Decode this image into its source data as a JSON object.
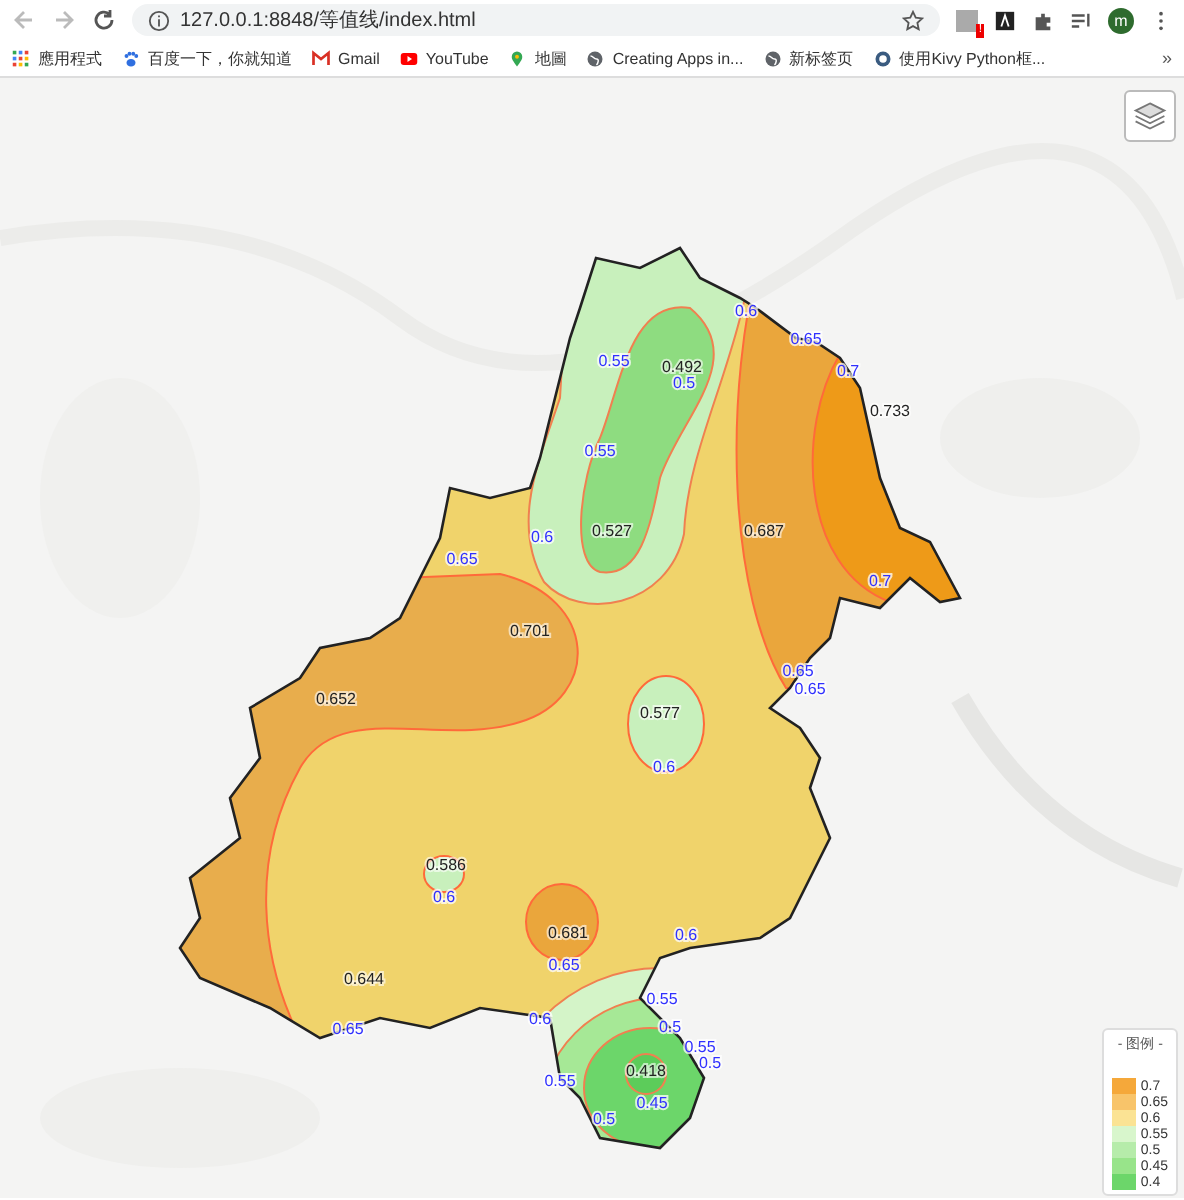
{
  "browser": {
    "url": "127.0.0.1:8848/等值线/index.html",
    "avatar": "m",
    "extension_badge": "!",
    "bookmarks": [
      {
        "kind": "apps",
        "label": "應用程式"
      },
      {
        "kind": "paw",
        "label": "百度一下，你就知道"
      },
      {
        "kind": "gmail",
        "label": "Gmail"
      },
      {
        "kind": "youtube",
        "label": "YouTube"
      },
      {
        "kind": "pin",
        "label": "地圖"
      },
      {
        "kind": "globe",
        "label": "Creating Apps in..."
      },
      {
        "kind": "globe",
        "label": "新标签页"
      },
      {
        "kind": "kivy",
        "label": "使用Kivy Python框..."
      }
    ],
    "more": "»"
  },
  "map": {
    "station_values": [
      "0.492",
      "0.733",
      "0.527",
      "0.687",
      "0.701",
      "0.652",
      "0.577",
      "0.586",
      "0.681",
      "0.644",
      "0.418"
    ],
    "contour_labels": [
      "0.6",
      "0.65",
      "0.55",
      "0.5",
      "0.7",
      "0.55",
      "0.65",
      "0.6",
      "0.7",
      "0.65",
      "0.65",
      "0.6",
      "0.6",
      "0.6",
      "0.65",
      "0.55",
      "0.65",
      "0.6",
      "0.55",
      "0.5",
      "0.55",
      "0.5",
      "0.45",
      "0.5"
    ]
  },
  "legend": {
    "title": "- 图例 -",
    "items": [
      {
        "label": "0.7",
        "color": "#f5a83a"
      },
      {
        "label": "0.65",
        "color": "#f8c46a"
      },
      {
        "label": "0.6",
        "color": "#fbe394"
      },
      {
        "label": "0.55",
        "color": "#d8f6cc"
      },
      {
        "label": "0.5",
        "color": "#b6ecaa"
      },
      {
        "label": "0.45",
        "color": "#98e48a"
      },
      {
        "label": "0.4",
        "color": "#6cd66a"
      }
    ]
  }
}
